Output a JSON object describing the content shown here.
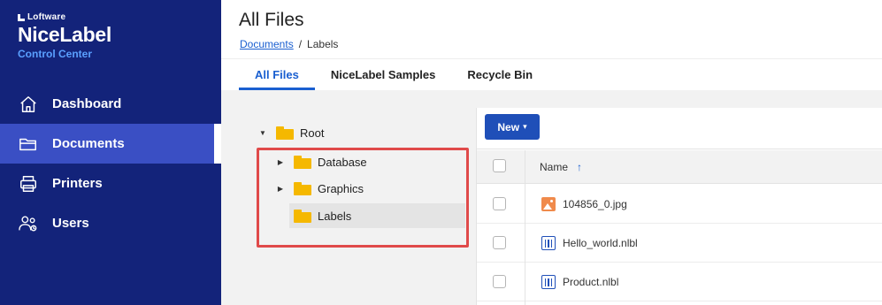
{
  "brand": {
    "vendor": "Loftware",
    "name": "NiceLabel",
    "sub": "Control Center"
  },
  "sidebar": {
    "items": [
      {
        "label": "Dashboard",
        "icon": "home-icon"
      },
      {
        "label": "Documents",
        "icon": "folder-icon",
        "active": true
      },
      {
        "label": "Printers",
        "icon": "printer-icon"
      },
      {
        "label": "Users",
        "icon": "users-icon"
      }
    ]
  },
  "header": {
    "title": "All Files",
    "breadcrumb": [
      "Documents",
      "/",
      "Labels"
    ]
  },
  "tabs": [
    {
      "label": "All Files",
      "active": true
    },
    {
      "label": "NiceLabel Samples"
    },
    {
      "label": "Recycle Bin"
    }
  ],
  "tree": {
    "root": "Root",
    "children": [
      "Database",
      "Graphics",
      "Labels"
    ]
  },
  "toolbar": {
    "new_label": "New",
    "new_caret": "▾"
  },
  "grid": {
    "name_header": "Name",
    "sort_glyph": "↑",
    "files": [
      {
        "name": "104856_0.jpg",
        "icon": "image-file-icon"
      },
      {
        "name": "Hello_world.nlbl",
        "icon": "label-file-icon"
      },
      {
        "name": "Product.nlbl",
        "icon": "label-file-icon"
      }
    ]
  },
  "colors": {
    "sidebar": "#13237a",
    "sidebar_active": "#3a4fc4",
    "accent": "#1a5fd0",
    "folder": "#f5b800",
    "highlight": "#e04a4a"
  }
}
